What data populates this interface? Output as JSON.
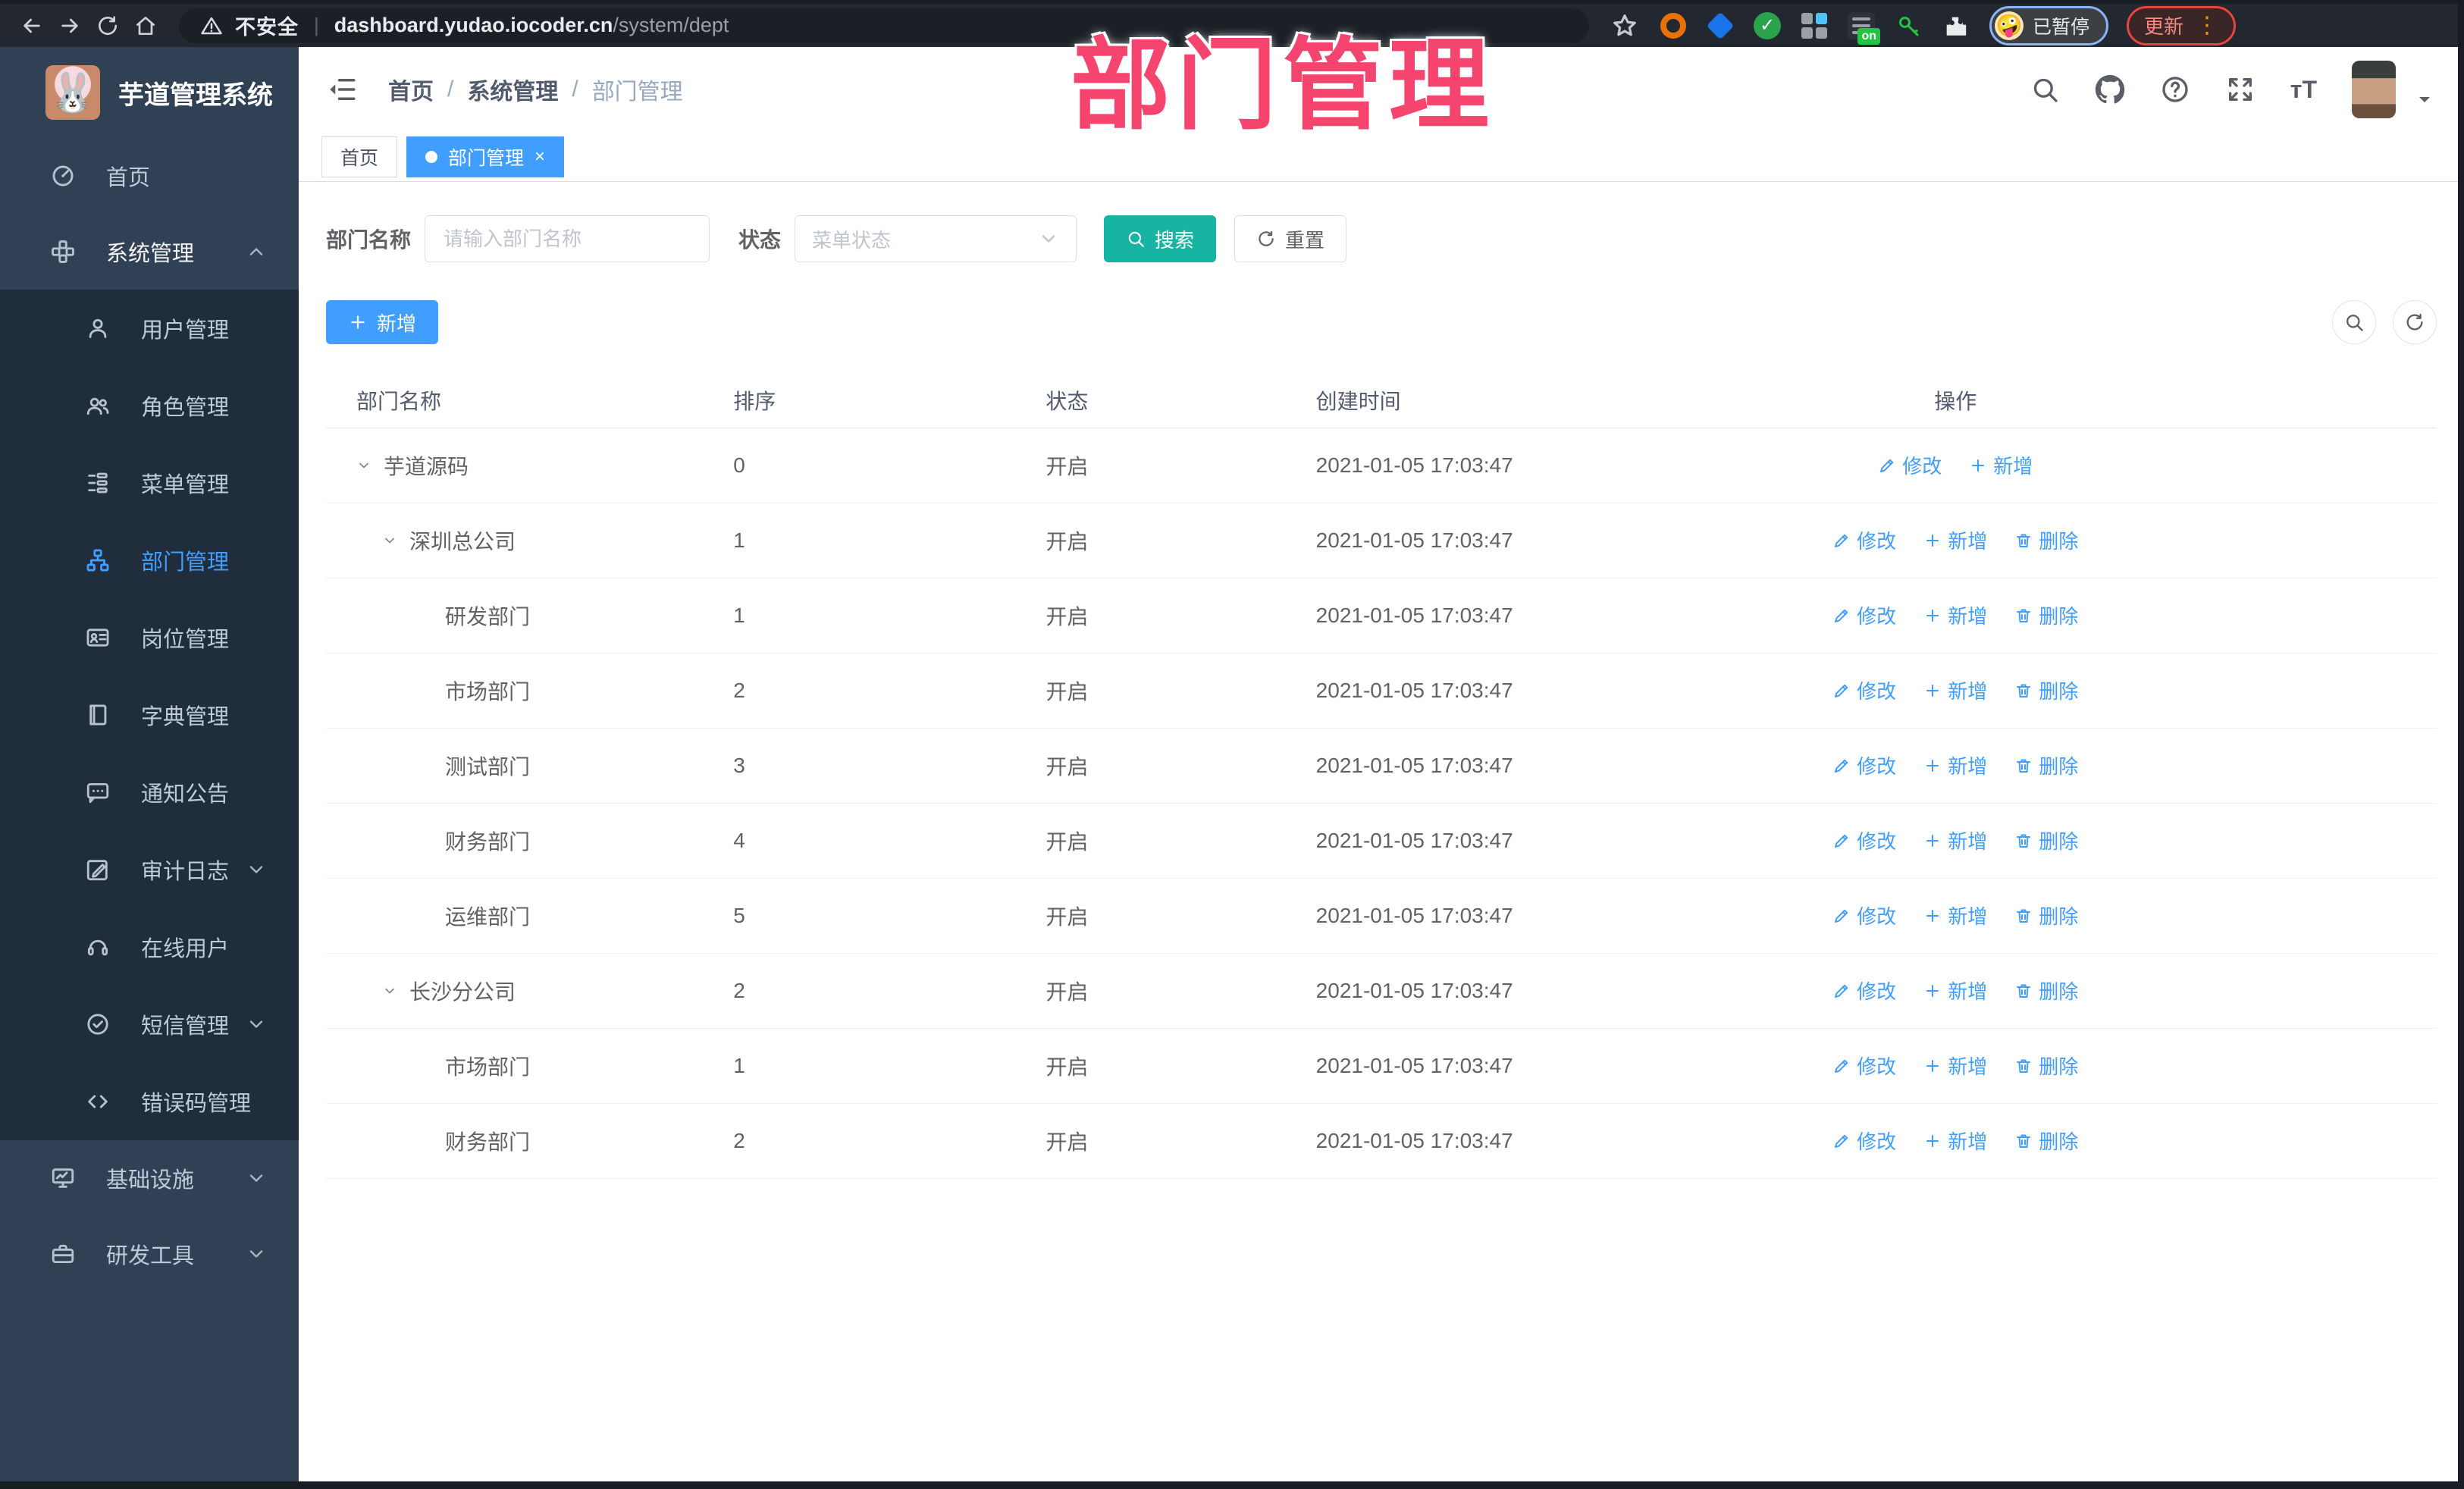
{
  "watermark": "部门管理",
  "browser": {
    "security_label": "不安全",
    "url_host": "dashboard.yudao.iocoder.cn",
    "url_path": "/system/dept",
    "profile_status": "已暂停",
    "update_label": "更新",
    "extensions": [
      {
        "name": "extension-orange-ring-icon",
        "kind": "ring",
        "color": "#e8710a"
      },
      {
        "name": "extension-blue-gem-icon",
        "kind": "diamond",
        "color": "#1a73e8"
      },
      {
        "name": "extension-green-check-icon",
        "kind": "check",
        "color": "#2ba24c",
        "glyph": "✓"
      },
      {
        "name": "extension-grid-icon",
        "kind": "grid",
        "color": "#9aa0a6",
        "accent": "#4fc3f7"
      },
      {
        "name": "extension-dark-on-icon",
        "kind": "dark-badge",
        "color": "#2d3138",
        "badge": "on",
        "badge_color": "#23c343"
      },
      {
        "name": "extension-green-key-icon",
        "kind": "key",
        "color": "#23c343"
      },
      {
        "name": "extension-puzzle-icon",
        "kind": "puzzle",
        "color": "#e8eaed"
      }
    ]
  },
  "app": {
    "title": "芋道管理系统",
    "logo_emoji": "🐰"
  },
  "sidebar": {
    "items": [
      {
        "label": "首页",
        "icon": "dashboard-icon",
        "level": 0
      },
      {
        "label": "系统管理",
        "icon": "system-component-icon",
        "level": 0,
        "chevron": "up",
        "open": true
      },
      {
        "label": "用户管理",
        "icon": "user-icon",
        "level": 1
      },
      {
        "label": "角色管理",
        "icon": "users-icon",
        "level": 1
      },
      {
        "label": "菜单管理",
        "icon": "menu-list-icon",
        "level": 1
      },
      {
        "label": "部门管理",
        "icon": "org-tree-icon",
        "level": 1,
        "active": true
      },
      {
        "label": "岗位管理",
        "icon": "id-card-icon",
        "level": 1
      },
      {
        "label": "字典管理",
        "icon": "dictionary-icon",
        "level": 1
      },
      {
        "label": "通知公告",
        "icon": "announcement-icon",
        "level": 1
      },
      {
        "label": "审计日志",
        "icon": "audit-log-icon",
        "level": 1,
        "chevron": "down"
      },
      {
        "label": "在线用户",
        "icon": "online-users-icon",
        "level": 1
      },
      {
        "label": "短信管理",
        "icon": "sms-icon",
        "level": 1,
        "chevron": "down"
      },
      {
        "label": "错误码管理",
        "icon": "error-code-icon",
        "level": 1
      },
      {
        "label": "基础设施",
        "icon": "infrastructure-icon",
        "level": 0,
        "chevron": "down"
      },
      {
        "label": "研发工具",
        "icon": "dev-tools-icon",
        "level": 0,
        "chevron": "down"
      }
    ]
  },
  "navbar": {
    "breadcrumb": [
      "首页",
      "系统管理",
      "部门管理"
    ]
  },
  "tabs": [
    {
      "label": "首页",
      "active": false
    },
    {
      "label": "部门管理",
      "active": true,
      "closable": true
    }
  ],
  "filters": {
    "dept_name_label": "部门名称",
    "dept_name_placeholder": "请输入部门名称",
    "dept_name_value": "",
    "status_label": "状态",
    "status_placeholder": "菜单状态",
    "search_label": "搜索",
    "reset_label": "重置"
  },
  "toolbar": {
    "add_label": "新增"
  },
  "table": {
    "columns": [
      "部门名称",
      "排序",
      "状态",
      "创建时间",
      "操作"
    ],
    "action_defs": {
      "modify": {
        "label": "修改",
        "icon": "edit-pencil-icon"
      },
      "add": {
        "label": "新增",
        "icon": "plus-icon"
      },
      "delete": {
        "label": "删除",
        "icon": "trash-icon"
      }
    },
    "rows": [
      {
        "name": "芋道源码",
        "level": 0,
        "expandable": true,
        "sort": "0",
        "status": "开启",
        "created": "2021-01-05 17:03:47",
        "actions": [
          "modify",
          "add"
        ]
      },
      {
        "name": "深圳总公司",
        "level": 1,
        "expandable": true,
        "sort": "1",
        "status": "开启",
        "created": "2021-01-05 17:03:47",
        "actions": [
          "modify",
          "add",
          "delete"
        ]
      },
      {
        "name": "研发部门",
        "level": 2,
        "expandable": false,
        "sort": "1",
        "status": "开启",
        "created": "2021-01-05 17:03:47",
        "actions": [
          "modify",
          "add",
          "delete"
        ]
      },
      {
        "name": "市场部门",
        "level": 2,
        "expandable": false,
        "sort": "2",
        "status": "开启",
        "created": "2021-01-05 17:03:47",
        "actions": [
          "modify",
          "add",
          "delete"
        ]
      },
      {
        "name": "测试部门",
        "level": 2,
        "expandable": false,
        "sort": "3",
        "status": "开启",
        "created": "2021-01-05 17:03:47",
        "actions": [
          "modify",
          "add",
          "delete"
        ]
      },
      {
        "name": "财务部门",
        "level": 2,
        "expandable": false,
        "sort": "4",
        "status": "开启",
        "created": "2021-01-05 17:03:47",
        "actions": [
          "modify",
          "add",
          "delete"
        ]
      },
      {
        "name": "运维部门",
        "level": 2,
        "expandable": false,
        "sort": "5",
        "status": "开启",
        "created": "2021-01-05 17:03:47",
        "actions": [
          "modify",
          "add",
          "delete"
        ]
      },
      {
        "name": "长沙分公司",
        "level": 1,
        "expandable": true,
        "sort": "2",
        "status": "开启",
        "created": "2021-01-05 17:03:47",
        "actions": [
          "modify",
          "add",
          "delete"
        ]
      },
      {
        "name": "市场部门",
        "level": 2,
        "expandable": false,
        "sort": "1",
        "status": "开启",
        "created": "2021-01-05 17:03:47",
        "actions": [
          "modify",
          "add",
          "delete"
        ]
      },
      {
        "name": "财务部门",
        "level": 2,
        "expandable": false,
        "sort": "2",
        "status": "开启",
        "created": "2021-01-05 17:03:47",
        "actions": [
          "modify",
          "add",
          "delete"
        ]
      }
    ]
  },
  "colors": {
    "primary": "#409eff",
    "search_button": "#17b3a3",
    "sidebar_bg": "#304156",
    "submenu_bg": "#1f2d3d",
    "watermark": "#f5446e"
  }
}
